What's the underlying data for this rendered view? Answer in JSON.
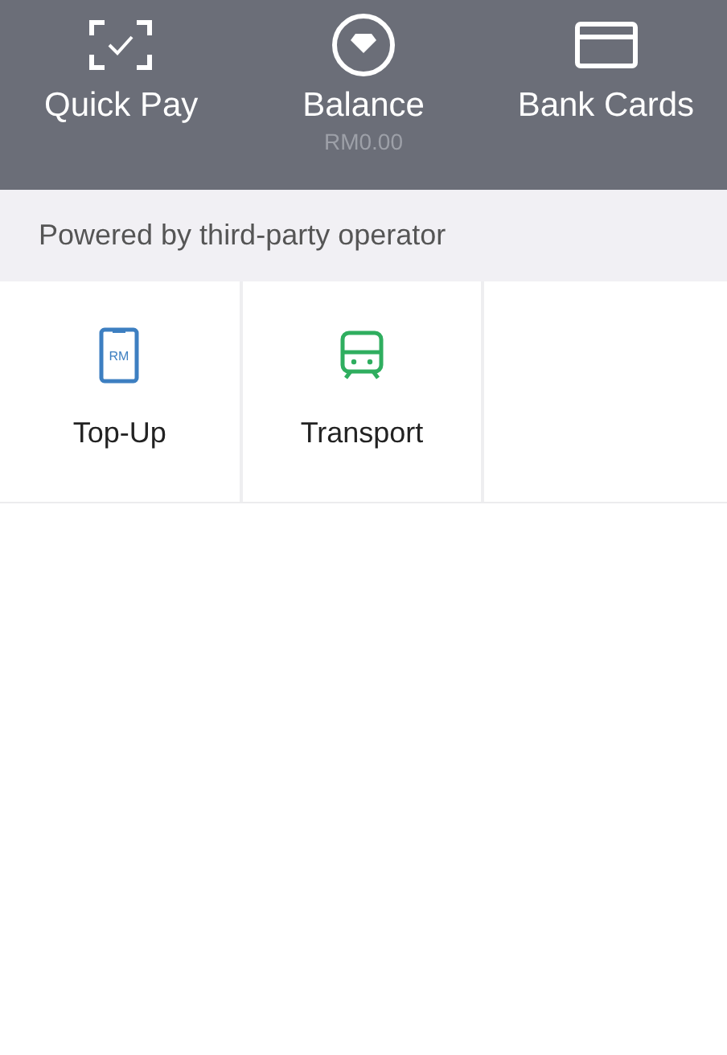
{
  "header": {
    "actions": [
      {
        "kind": "scan",
        "label": "Quick Pay"
      },
      {
        "kind": "balance",
        "label": "Balance",
        "sublabel": "RM0.00"
      },
      {
        "kind": "card",
        "label": "Bank Cards"
      }
    ]
  },
  "section_title": "Powered by third-party operator",
  "services": [
    {
      "kind": "topup",
      "label": "Top-Up",
      "icon_text": "RM",
      "color": "#3d7fc1"
    },
    {
      "kind": "bus",
      "label": "Transport",
      "color": "#2fae5f"
    }
  ]
}
